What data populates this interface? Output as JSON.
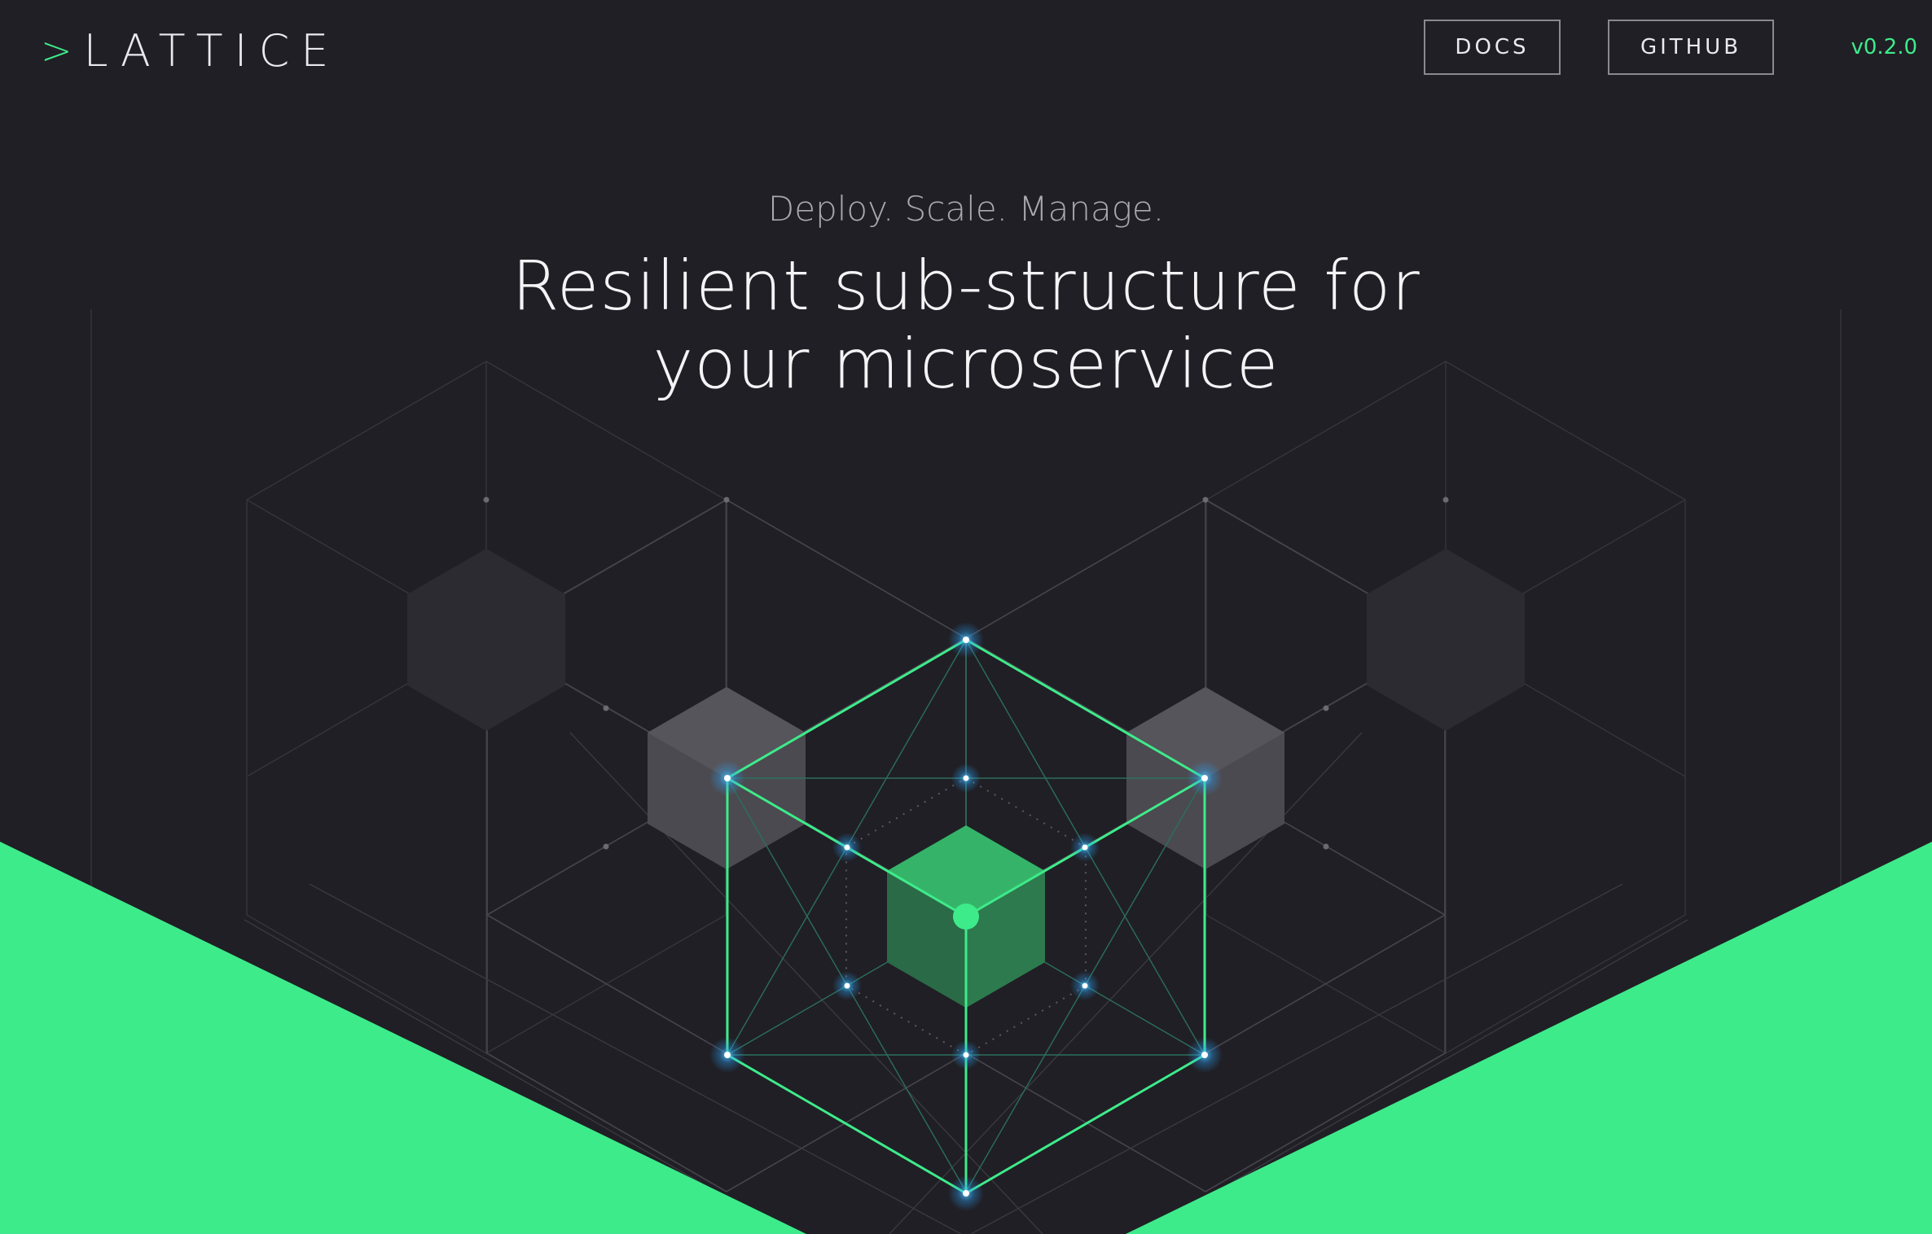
{
  "header": {
    "logo_caret": ">",
    "logo_text": "LATTICE",
    "nav": {
      "docs_label": "DOCS",
      "github_label": "GITHUB",
      "version": "v0.2.0"
    }
  },
  "hero": {
    "tagline": "Deploy. Scale. Manage.",
    "headline_line1": "Resilient sub-structure for",
    "headline_line2": "your microservice"
  },
  "colors": {
    "background": "#201f25",
    "accent": "#3eeb8a",
    "text": "#f4f4f7",
    "muted_text": "#a9a8b0"
  },
  "illustration": {
    "name": "lattice-cube-illustration",
    "icons": [
      "hex-cube-icon",
      "glow-node-icon"
    ]
  }
}
